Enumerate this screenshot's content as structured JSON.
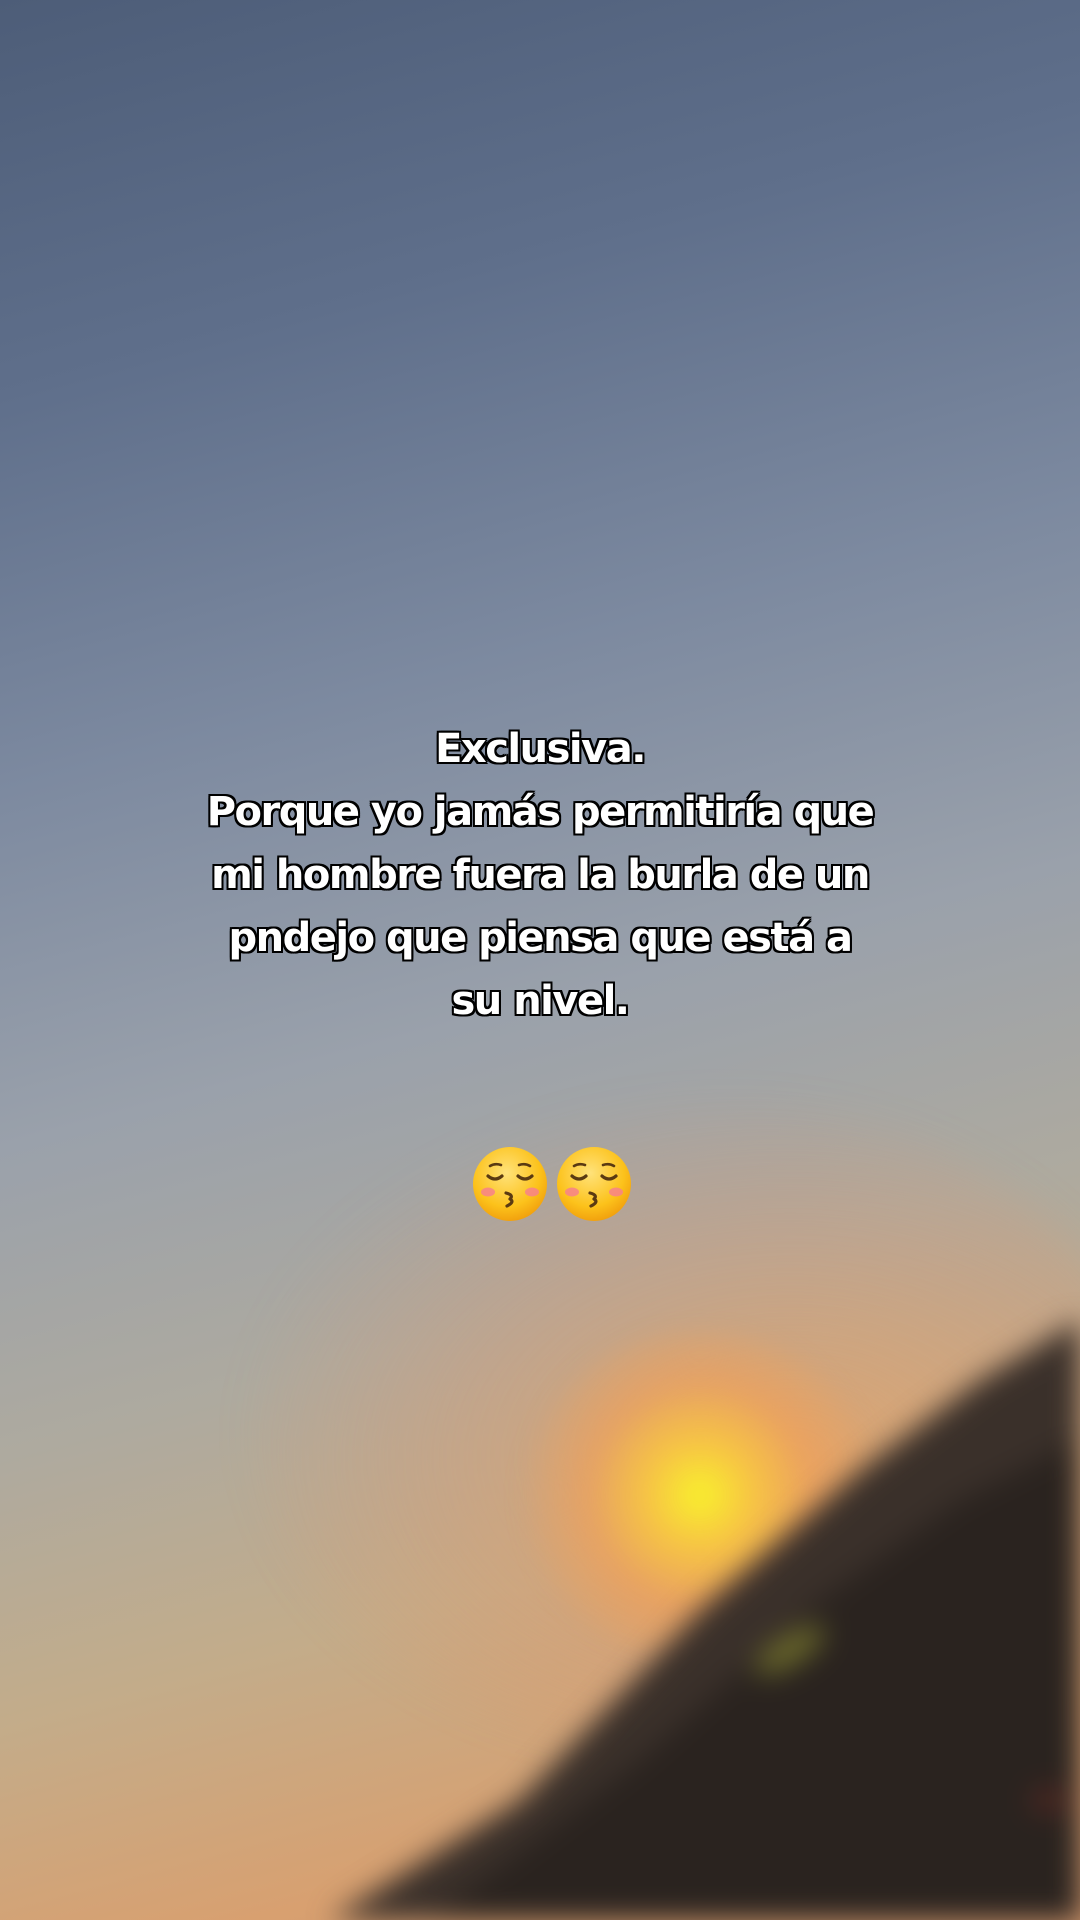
{
  "caption": {
    "lines": [
      "Exclusiva.",
      "Porque yo jamás permitiría que",
      "mi hombre fuera la burla de un",
      "pndejo que piensa que está a",
      "su nivel."
    ]
  },
  "emojis": [
    "kissing-face-with-closed-eyes",
    "kissing-face-with-closed-eyes"
  ],
  "colors": {
    "sky_top": "#4d5d78",
    "sky_mid": "#9aa1ab",
    "sunset_orange": "#d8a070",
    "sun_yellow": "#f8f028",
    "hill_dark": "#2e2622",
    "caption_text": "#ffffff",
    "caption_outline": "#000000"
  }
}
